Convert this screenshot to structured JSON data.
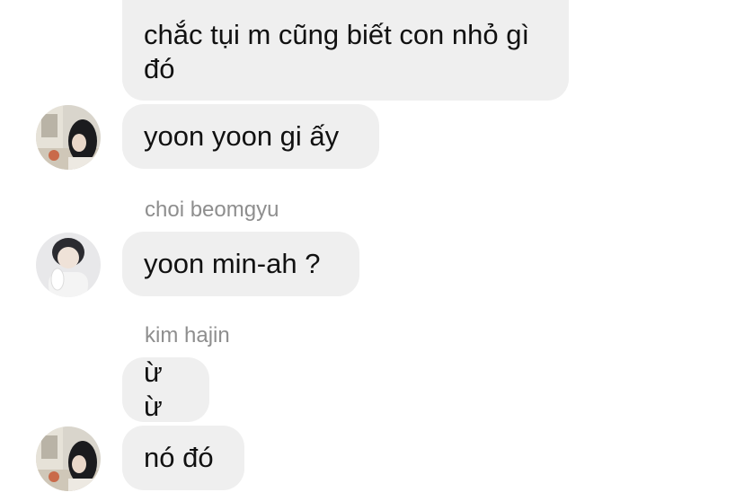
{
  "messages": [
    {
      "text": "chắc tụi m cũng biết con nhỏ gì đó"
    },
    {
      "text": "yoon yoon gi ấy"
    },
    {
      "sender": "choi beomgyu",
      "text": "yoon min-ah ?"
    },
    {
      "sender": "kim hajin",
      "text": "ừ ừ"
    },
    {
      "text": "nó đó"
    }
  ],
  "avatars": {
    "first": "avatar-girl-dark-hair",
    "second": "avatar-boy-with-plush",
    "third": "avatar-girl-dark-hair"
  },
  "colors": {
    "bubble": "#efefef",
    "text": "#111111",
    "sender_name": "#8e8e8e",
    "background": "#ffffff"
  }
}
